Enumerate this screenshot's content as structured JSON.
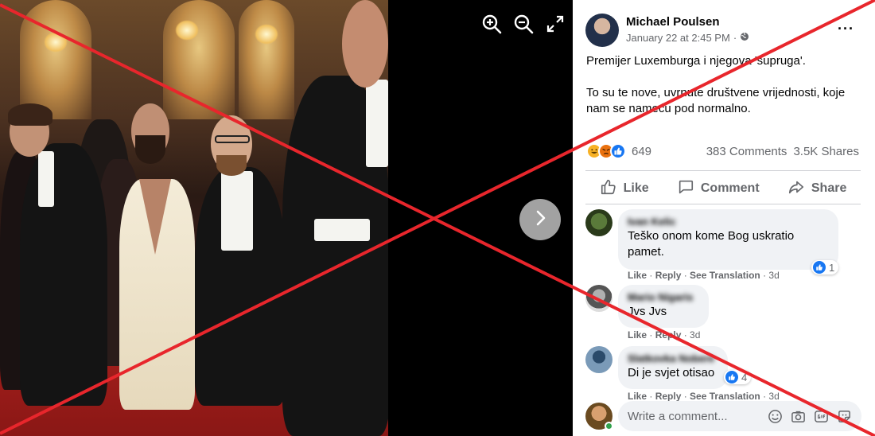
{
  "post": {
    "author_name": "Michael Poulsen",
    "date": "January 22 at 2:45 PM",
    "visibility_separator": "·",
    "more_options": "···",
    "text_line_1": "Premijer Luxemburga i njegova 'supruga'.",
    "text_line_2": "To su te nove, uvrnute društvene vrijednosti, koje nam se nameću pod normalno."
  },
  "stats": {
    "reaction_count": "649",
    "comments": "383 Comments",
    "shares": "3.5K Shares"
  },
  "actions": {
    "like": "Like",
    "comment": "Comment",
    "share": "Share"
  },
  "comments": [
    {
      "name": "Ivan Kelic",
      "text": "Teško onom kome Bog uskratio pamet.",
      "reaction_count": "1",
      "like": "Like",
      "reply": "Reply",
      "see_translation": "See Translation",
      "time": "3d"
    },
    {
      "name": "Mario Nigaris",
      "text": "Jvs Jvs",
      "like": "Like",
      "reply": "Reply",
      "time": "3d"
    },
    {
      "name": "Slatkovka Nobere",
      "text": "Di je svjet otisao",
      "reaction_count": "4",
      "like": "Like",
      "reply": "Reply",
      "see_translation": "See Translation",
      "time": "3d"
    }
  ],
  "composer": {
    "placeholder": "Write a comment..."
  },
  "colors": {
    "accent": "#1877f2",
    "overlay_x": "#e8262c",
    "online": "#31a24c"
  },
  "icons": {
    "zoom_in": "zoom-in-icon",
    "zoom_out": "zoom-out-icon",
    "fullscreen": "fullscreen-icon",
    "next": "chevron-right-icon",
    "globe": "globe-icon"
  }
}
